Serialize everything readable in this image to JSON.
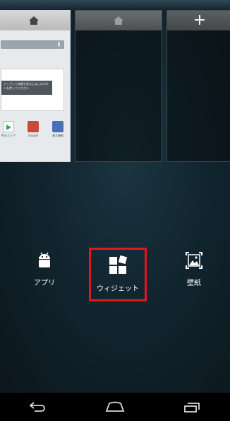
{
  "home_screens": {
    "add_label": "+",
    "screen1": {
      "card_text": "アップして詳細を見るにはこのボタンを押してください",
      "apps": [
        {
          "label": "Playストア",
          "color": "#ffffff"
        },
        {
          "label": "Google",
          "color": "#c94a3a"
        },
        {
          "label": "基本機能",
          "color": "#4a6fb5"
        }
      ]
    }
  },
  "options": {
    "apps": {
      "label": "アプリ"
    },
    "widgets": {
      "label": "ウィジェット"
    },
    "wallpaper": {
      "label": "壁紙"
    }
  },
  "highlight_color": "#e8141b",
  "navbar": {
    "back": "back-icon",
    "home": "home-icon",
    "recents": "recents-icon"
  }
}
